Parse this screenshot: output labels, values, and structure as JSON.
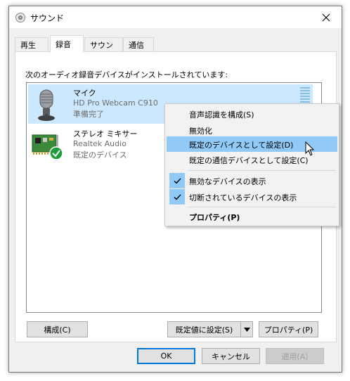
{
  "window": {
    "title": "サウンド",
    "close_glyph": "✕"
  },
  "tabs": [
    {
      "label": "再生"
    },
    {
      "label": "録音"
    },
    {
      "label": "サウンド"
    },
    {
      "label": "通信"
    }
  ],
  "instruction": "次のオーディオ録音デバイスがインストールされています:",
  "devices": [
    {
      "name": "マイク",
      "model": "HD Pro Webcam C910",
      "status": "準備完了",
      "icon": "microphone-icon"
    },
    {
      "name": "ステレオ ミキサー",
      "model": "Realtek Audio",
      "status": "既定のデバイス",
      "icon": "sound-card-icon"
    }
  ],
  "buttons": {
    "configure": "構成(C)",
    "set_default": "既定値に設定(S)",
    "properties": "プロパティ(P)",
    "ok": "OK",
    "cancel": "キャンセル",
    "apply": "適用(A)"
  },
  "context_menu": {
    "items": [
      {
        "label": "音声認識を構成(S)"
      },
      {
        "label": "無効化"
      },
      {
        "label": "既定のデバイスとして設定(D)"
      },
      {
        "label": "既定の通信デバイスとして設定(C)"
      },
      {
        "label": "無効なデバイスの表示",
        "checked": true
      },
      {
        "label": "切断されているデバイスの表示",
        "checked": true
      },
      {
        "label": "プロパティ(P)"
      }
    ]
  },
  "colors": {
    "accent": "#0078d7",
    "selection": "#cce8ff",
    "menu_highlight": "#91c9f7",
    "default_check": "#1e9e3a"
  }
}
